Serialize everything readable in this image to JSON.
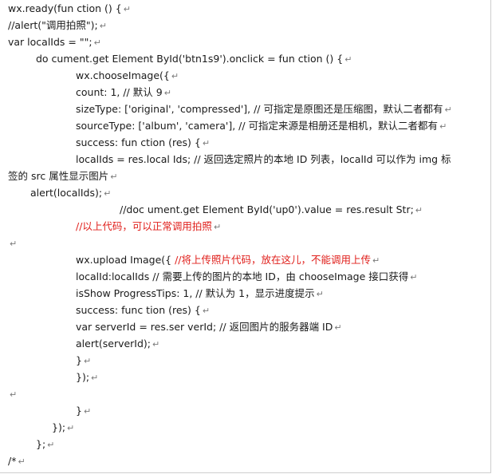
{
  "document": {
    "lines": [
      {
        "text": "wx.ready(fun ction () {",
        "mark": "↵"
      },
      {
        "text": "//alert(\"调用拍照\");",
        "mark": "↵"
      },
      {
        "text": "var localIds = \"\";",
        "mark": "↵"
      },
      {
        "text": "do cument.get Element ById('btn1s9').onclick = fun ction () {",
        "mark": "↵"
      },
      {
        "text": "wx.chooseImage({",
        "mark": "↵"
      },
      {
        "text": "count: 1, // 默认 9",
        "mark": "↵"
      },
      {
        "text": "sizeType: ['original', 'compressed'], // 可指定是原图还是压缩图，默认二者都有",
        "mark": "↵"
      },
      {
        "text": "sourceType: ['album', 'camera'], // 可指定来源是相册还是相机，默认二者都有",
        "mark": "↵"
      },
      {
        "text": "success: fun ction (res) {",
        "mark": "↵"
      },
      {
        "text": "localIds = res.local Ids; // 返回选定照片的本地 ID 列表，localId 可以作为 img 标",
        "mark": ""
      },
      {
        "text": "签的 src 属性显示图片",
        "mark": "↵"
      },
      {
        "text": "alert(localIds);",
        "mark": "↵"
      },
      {
        "text": "//doc ument.get Element ById('up0').value = res.result Str;",
        "mark": "↵"
      },
      {
        "text": "//以上代码，可以正常调用拍照",
        "mark": "↵"
      },
      {
        "text": "",
        "mark": "↵"
      },
      {
        "text": "wx.upload Image({   //将上传照片代码，放在这儿，不能调用上传",
        "mark": "↵"
      },
      {
        "text": "localId:localIds // 需要上传的图片的本地 ID，由 chooseImage 接口获得",
        "mark": "↵"
      },
      {
        "text": "isShow ProgressTips: 1, // 默认为 1，显示进度提示",
        "mark": "↵"
      },
      {
        "text": "success: func tion (res) {",
        "mark": "↵"
      },
      {
        "text": "var serverId = res.ser verId; // 返回图片的服务器端 ID",
        "mark": "↵"
      },
      {
        "text": "alert(serverId);",
        "mark": "↵"
      },
      {
        "text": "}",
        "mark": "↵"
      },
      {
        "text": "});",
        "mark": "↵"
      },
      {
        "text": "",
        "mark": "↵"
      },
      {
        "text": "}",
        "mark": "↵"
      },
      {
        "text": "});",
        "mark": "↵"
      },
      {
        "text": "};",
        "mark": "↵"
      },
      {
        "text": "/*",
        "mark": "↵"
      }
    ]
  }
}
